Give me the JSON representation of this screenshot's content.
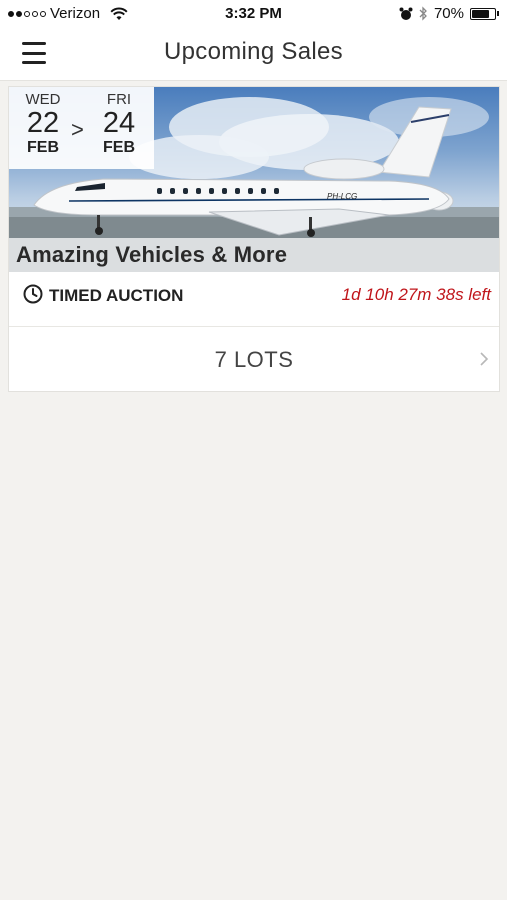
{
  "status_bar": {
    "carrier": "Verizon",
    "time": "3:32 PM",
    "battery": "70%",
    "battery_level": 0.7
  },
  "nav": {
    "title": "Upcoming Sales"
  },
  "sale": {
    "start": {
      "dow": "WED",
      "day": "22",
      "month": "FEB"
    },
    "arrow": ">",
    "end": {
      "dow": "FRI",
      "day": "24",
      "month": "FEB"
    },
    "title": "Amazing Vehicles & More",
    "auction_type": "TIMED AUCTION",
    "time_left": "1d 10h 27m 38s left",
    "lots": "7 LOTS",
    "aircraft_registration": "PH-LCG"
  },
  "colors": {
    "time_left": "#c0161b",
    "background": "#f3f2ef"
  }
}
